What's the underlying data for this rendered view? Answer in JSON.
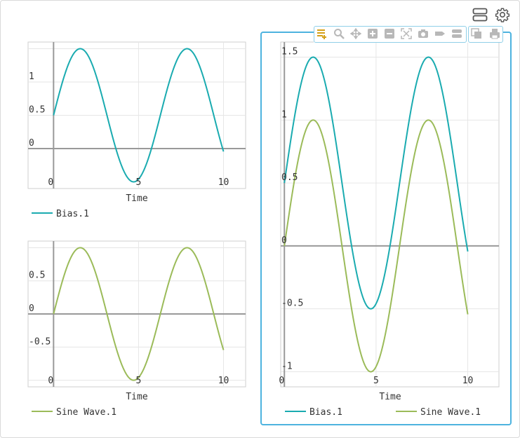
{
  "header": {
    "layout_icon": "rows-layout-icon",
    "settings_icon": "gear-icon"
  },
  "toolbar": {
    "icons": [
      "legend-add-icon",
      "zoom-icon",
      "pan-icon",
      "zoom-in-icon",
      "zoom-out-icon",
      "fit-icon",
      "camera-icon",
      "tag-icon",
      "split-icon",
      "copy-icon",
      "print-icon"
    ],
    "active_color": "#d4a017",
    "icon_color": "#b8b8b8"
  },
  "colors": {
    "bias": "#1aabb0",
    "sine": "#9bbb59",
    "grid": "#e6e6e6",
    "axis": "#999999",
    "selected_border": "#4db3df"
  },
  "chart_data": [
    {
      "type": "line",
      "xlabel": "Time",
      "x_tick_labels": [
        "0",
        "5",
        "10"
      ],
      "y_tick_labels": [
        "0",
        "0.5",
        "1"
      ],
      "xlim": [
        -1.5,
        11.3
      ],
      "ylim": [
        -0.6,
        1.6
      ],
      "series": [
        {
          "name": "Bias.1",
          "color": "#1aabb0",
          "function": "sin(x)+0.5",
          "x_range": [
            0,
            10
          ]
        }
      ]
    },
    {
      "type": "line",
      "xlabel": "Time",
      "x_tick_labels": [
        "0",
        "5",
        "10"
      ],
      "y_tick_labels": [
        "0.5",
        "0",
        "-0.5"
      ],
      "xlim": [
        -1.5,
        11.3
      ],
      "ylim": [
        -1.1,
        1.1
      ],
      "series": [
        {
          "name": "Sine Wave.1",
          "color": "#9bbb59",
          "function": "sin(x)",
          "x_range": [
            0,
            10
          ]
        }
      ]
    },
    {
      "type": "line",
      "xlabel": "Time",
      "x_tick_labels": [
        "0",
        "5",
        "10"
      ],
      "y_tick_labels": [
        "1.5",
        "1",
        "0.5",
        "0",
        "-0.5",
        "-1"
      ],
      "xlim": [
        -0.2,
        11.7
      ],
      "ylim": [
        -1.12,
        1.62
      ],
      "series": [
        {
          "name": "Bias.1",
          "color": "#1aabb0",
          "function": "sin(x)+0.5",
          "x_range": [
            0,
            10
          ]
        },
        {
          "name": "Sine Wave.1",
          "color": "#9bbb59",
          "function": "sin(x)",
          "x_range": [
            0,
            10
          ]
        }
      ]
    }
  ]
}
